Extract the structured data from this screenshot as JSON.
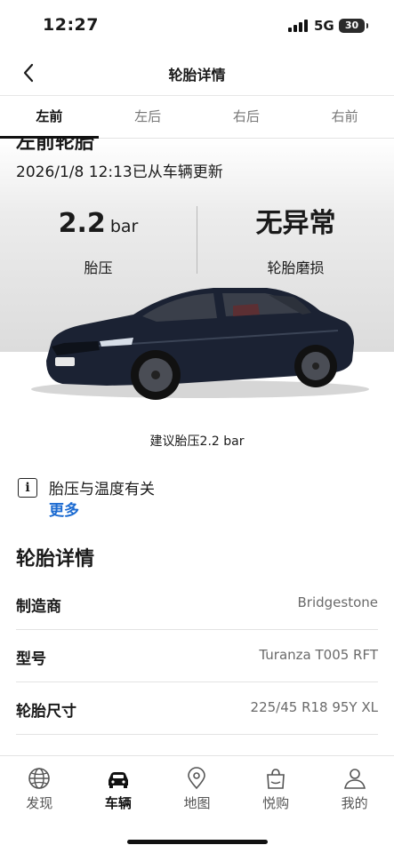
{
  "status_bar": {
    "time": "12:27",
    "network": "5G",
    "battery": "30"
  },
  "nav": {
    "title": "轮胎详情",
    "back_icon": "chevron-left-icon"
  },
  "tabs": [
    {
      "label": "左前",
      "active": true
    },
    {
      "label": "左后",
      "active": false
    },
    {
      "label": "右后",
      "active": false
    },
    {
      "label": "右前",
      "active": false
    }
  ],
  "hero": {
    "heading": "左前轮胎",
    "updated": "2026/1/8 12:13已从车辆更新",
    "pressure": {
      "value": "2.2",
      "unit": "bar",
      "label": "胎压"
    },
    "wear": {
      "value": "无异常",
      "label": "轮胎磨损"
    },
    "recommended": "建议胎压2.2 bar"
  },
  "info": {
    "icon": "info-icon",
    "text": "胎压与温度有关",
    "more": "更多"
  },
  "details": {
    "title": "轮胎详情",
    "rows": [
      {
        "key": "制造商",
        "value": "Bridgestone"
      },
      {
        "key": "型号",
        "value": "Turanza T005 RFT"
      },
      {
        "key": "轮胎尺寸",
        "value": "225/45 R18 95Y XL"
      }
    ]
  },
  "bottom_nav": [
    {
      "label": "发现",
      "icon": "globe-icon",
      "active": false
    },
    {
      "label": "车辆",
      "icon": "car-icon",
      "active": true
    },
    {
      "label": "地图",
      "icon": "map-pin-icon",
      "active": false
    },
    {
      "label": "悦购",
      "icon": "shopping-bag-icon",
      "active": false
    },
    {
      "label": "我的",
      "icon": "person-icon",
      "active": false
    }
  ],
  "colors": {
    "link": "#1c6bd1",
    "car_body": "#1b2233"
  }
}
